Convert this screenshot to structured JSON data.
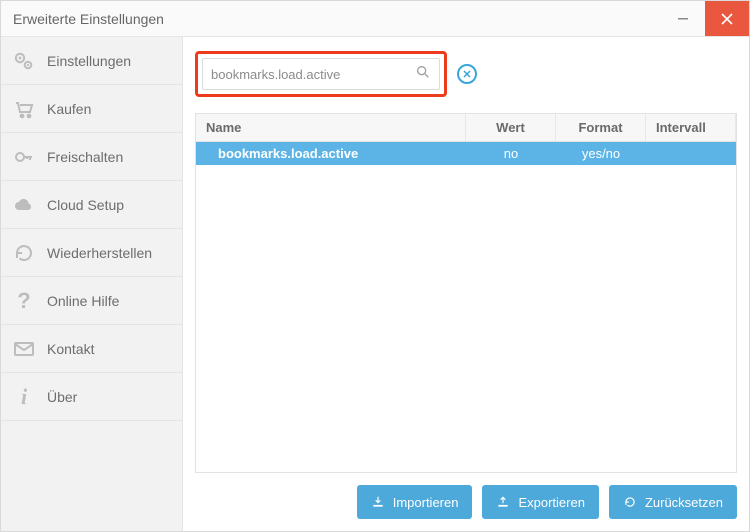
{
  "window": {
    "title": "Erweiterte Einstellungen"
  },
  "sidebar": {
    "items": [
      {
        "label": "Einstellungen"
      },
      {
        "label": "Kaufen"
      },
      {
        "label": "Freischalten"
      },
      {
        "label": "Cloud Setup"
      },
      {
        "label": "Wiederherstellen"
      },
      {
        "label": "Online Hilfe"
      },
      {
        "label": "Kontakt"
      },
      {
        "label": "Über"
      }
    ]
  },
  "search": {
    "value": "bookmarks.load.active"
  },
  "table": {
    "headers": {
      "name": "Name",
      "wert": "Wert",
      "format": "Format",
      "intervall": "Intervall"
    },
    "rows": [
      {
        "name": "bookmarks.load.active",
        "wert": "no",
        "format": "yes/no",
        "intervall": ""
      }
    ]
  },
  "buttons": {
    "import": "Importieren",
    "export": "Exportieren",
    "reset": "Zurücksetzen"
  },
  "colors": {
    "accent": "#4ea9db",
    "highlight": "#ee3b1c",
    "row_selected": "#5bb4e5",
    "close": "#e9573e"
  }
}
